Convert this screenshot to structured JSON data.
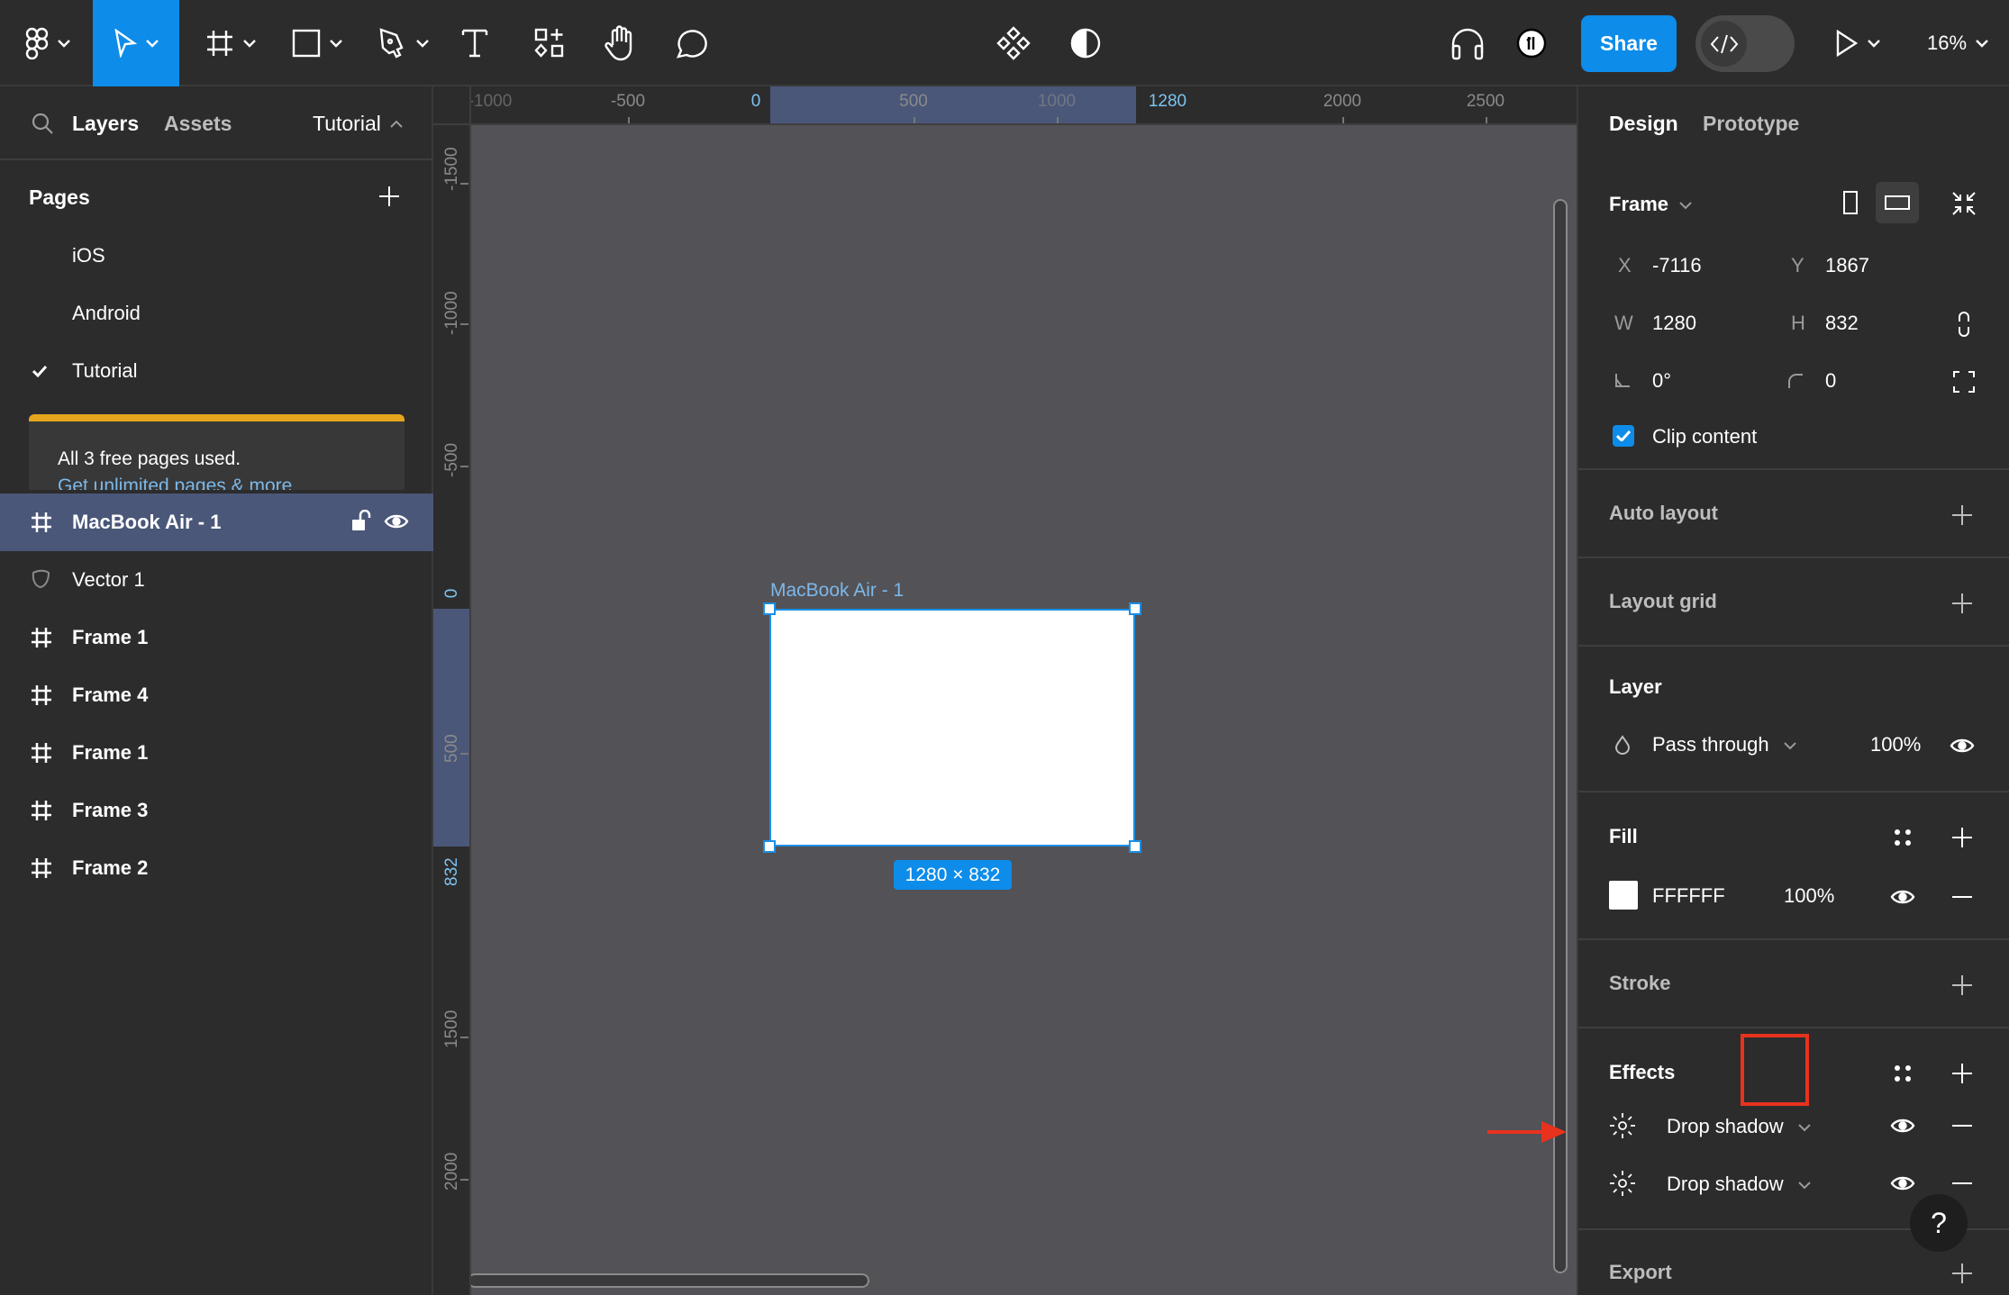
{
  "toolbar": {
    "tools": [
      {
        "name": "main-menu",
        "icon": "figma-logo-icon",
        "has_caret": true
      },
      {
        "name": "move-tool",
        "icon": "cursor-arrow-icon",
        "has_caret": true,
        "active": true
      },
      {
        "name": "frame-tool",
        "icon": "frame-hash-icon",
        "has_caret": true
      },
      {
        "name": "shape-tool",
        "icon": "rectangle-icon",
        "has_caret": true
      },
      {
        "name": "pen-tool",
        "icon": "pen-nib-icon",
        "has_caret": true
      },
      {
        "name": "text-tool",
        "icon": "text-t-icon",
        "has_caret": false
      },
      {
        "name": "resources-tool",
        "icon": "resources-icon",
        "has_caret": false
      },
      {
        "name": "hand-tool",
        "icon": "hand-icon",
        "has_caret": false
      },
      {
        "name": "comment-tool",
        "icon": "comment-bubble-icon",
        "has_caret": false
      }
    ],
    "center_icons": [
      "components-icon",
      "contrast-icon"
    ],
    "right_icons": [
      "headphones-icon",
      "user-avatar-icon"
    ],
    "share_label": "Share",
    "dev_mode_icon": "code-brackets-icon",
    "present_icon": "play-icon",
    "zoom_level": "16%"
  },
  "left_panel": {
    "tabs": {
      "layers": "Layers",
      "assets": "Assets"
    },
    "page_dropdown": "Tutorial",
    "pages_title": "Pages",
    "pages": [
      {
        "label": "iOS",
        "current": false
      },
      {
        "label": "Android",
        "current": false
      },
      {
        "label": "Tutorial",
        "current": true
      }
    ],
    "upsell": {
      "message": "All 3 free pages used.",
      "link": "Get unlimited pages & more"
    },
    "layers": [
      {
        "label": "MacBook Air - 1",
        "type": "frame",
        "selected": true
      },
      {
        "label": "Vector 1",
        "type": "vector",
        "selected": false
      },
      {
        "label": "Frame 1",
        "type": "frame",
        "selected": false
      },
      {
        "label": "Frame 4",
        "type": "frame",
        "selected": false
      },
      {
        "label": "Frame 1",
        "type": "frame",
        "selected": false
      },
      {
        "label": "Frame 3",
        "type": "frame",
        "selected": false
      },
      {
        "label": "Frame 2",
        "type": "frame",
        "selected": false
      }
    ]
  },
  "rulers": {
    "top": [
      "-1000",
      "-500",
      "0",
      "500",
      "1000",
      "1280",
      "2000",
      "2500"
    ],
    "top_accent": [
      "0",
      "1280"
    ],
    "left": [
      "-1500",
      "-1000",
      "-500",
      "0",
      "500",
      "832",
      "1500",
      "2000"
    ],
    "left_accent": [
      "0",
      "832"
    ]
  },
  "canvas": {
    "frame_name": "MacBook Air - 1",
    "frame_size_badge": "1280 × 832",
    "frame_fill": "#FFFFFF",
    "background": "#535256",
    "selection_color": "#1B8FE6"
  },
  "right_panel": {
    "tabs": {
      "design": "Design",
      "prototype": "Prototype"
    },
    "frame": {
      "title": "Frame",
      "x_label": "X",
      "x": "-7116",
      "y_label": "Y",
      "y": "1867",
      "w_label": "W",
      "w": "1280",
      "h_label": "H",
      "h": "832",
      "rotation": "0°",
      "corner_radius": "0",
      "clip_content_label": "Clip content",
      "clip_content": true
    },
    "auto_layout": {
      "title": "Auto layout"
    },
    "layout_grid": {
      "title": "Layout grid"
    },
    "layer": {
      "title": "Layer",
      "blend_mode": "Pass through",
      "opacity": "100%"
    },
    "fill": {
      "title": "Fill",
      "hex": "FFFFFF",
      "opacity": "100%"
    },
    "stroke": {
      "title": "Stroke"
    },
    "effects": {
      "title": "Effects",
      "items": [
        {
          "label": "Drop shadow"
        },
        {
          "label": "Drop shadow"
        }
      ]
    },
    "export": {
      "title": "Export"
    },
    "help_label": "?"
  },
  "annotations": {
    "highlight_color": "#E8321E",
    "highlight_target": "effects-add-button"
  }
}
